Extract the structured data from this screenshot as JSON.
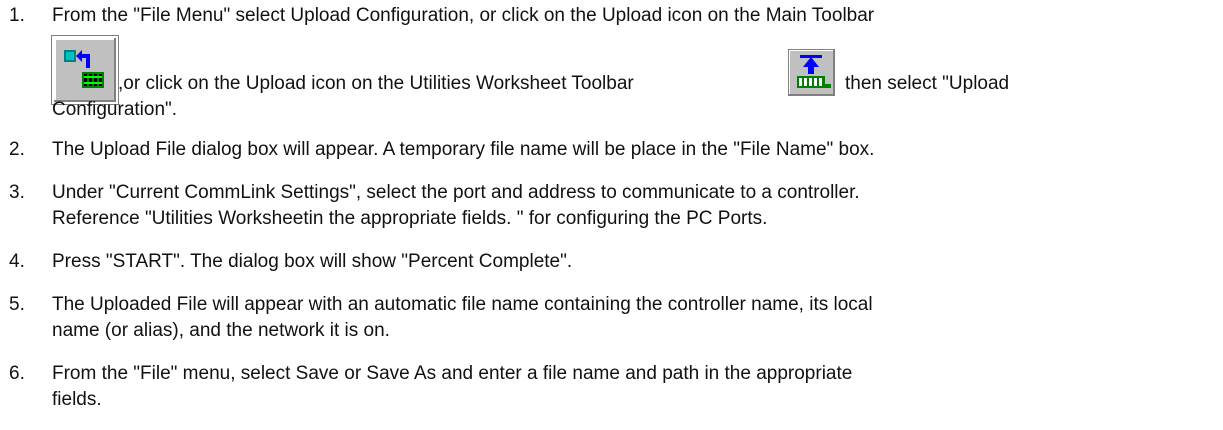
{
  "steps": [
    {
      "num": "1.",
      "line1": "From the \"File Menu\" select Upload Configuration, or click on the Upload icon on the Main Toolbar",
      "line2a": ",or click on the Upload icon on the Utilities Worksheet Toolbar",
      "line2b": "then select \"Upload",
      "line3": "Configuration\"."
    },
    {
      "num": "2.",
      "line1": "The Upload File dialog box will appear. A temporary file name will be place in the \"File Name\" box."
    },
    {
      "num": "3.",
      "line1": "Under \"Current CommLink Settings\", select the port and address to communicate to a controller.",
      "line2": "Reference \"Utilities Worksheetin the appropriate fields. \" for configuring the PC Ports."
    },
    {
      "num": "4.",
      "line1": "Press \"START\". The dialog box will show \"Percent Complete\"."
    },
    {
      "num": "5.",
      "line1": "The Uploaded File will appear with an automatic file name containing the controller name, its local",
      "line2": "name (or alias), and the network it is on."
    },
    {
      "num": "6.",
      "line1": "From the \"File\" menu, select Save or Save As and enter a file name and path in the appropriate",
      "line2": "fields."
    }
  ],
  "icons": {
    "main_toolbar_icon": "upload-config-toolbar-icon",
    "utilities_toolbar_icon": "upload-worksheet-toolbar-icon"
  },
  "colors": {
    "text": "#111111",
    "icon_face": "#c0c0c0",
    "icon_teal": "#008080",
    "icon_blue": "#0000ff",
    "icon_green": "#00c000"
  }
}
